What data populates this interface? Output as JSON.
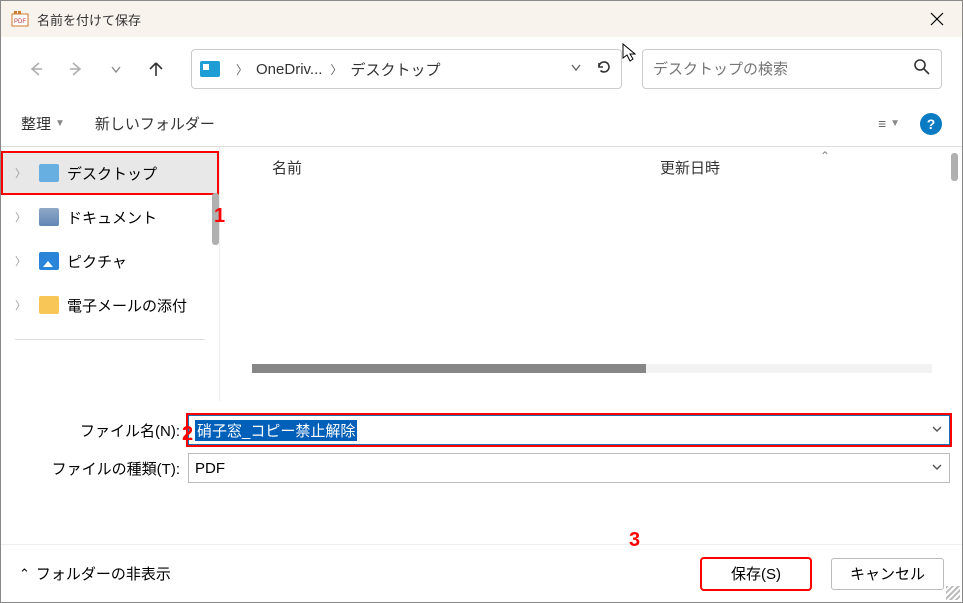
{
  "title": "名前を付けて保存",
  "breadcrumb": {
    "part1": "OneDriv...",
    "part2": "デスクトップ"
  },
  "search": {
    "placeholder": "デスクトップの検索"
  },
  "toolbar": {
    "organize": "整理",
    "newfolder": "新しいフォルダー"
  },
  "sidebar": {
    "items": [
      {
        "label": "デスクトップ"
      },
      {
        "label": "ドキュメント"
      },
      {
        "label": "ピクチャ"
      },
      {
        "label": "電子メールの添付"
      }
    ]
  },
  "columns": {
    "name": "名前",
    "date": "更新日時"
  },
  "form": {
    "filename_label": "ファイル名(N):",
    "filename_value": "硝子窓_コピー禁止解除",
    "filetype_label": "ファイルの種類(T):",
    "filetype_value": "PDF"
  },
  "footer": {
    "hide": "フォルダーの非表示",
    "save": "保存(S)",
    "cancel": "キャンセル"
  },
  "annotations": {
    "a1": "1",
    "a2": "2",
    "a3": "3"
  }
}
